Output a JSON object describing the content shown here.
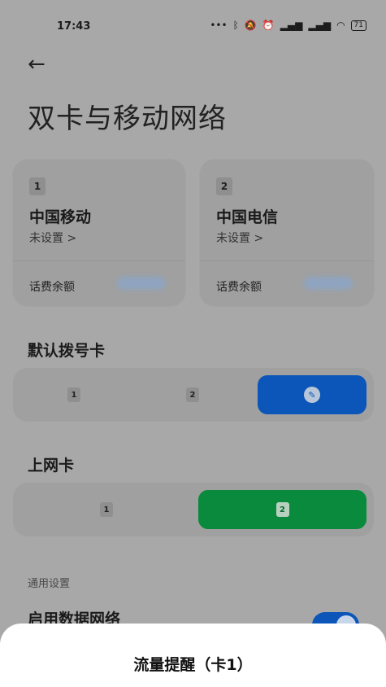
{
  "status_bar": {
    "time": "17:43",
    "battery": "71"
  },
  "header": {
    "title": "双卡与移动网络"
  },
  "sim_cards": [
    {
      "slot": "1",
      "carrier": "中国移动",
      "status": "未设置 >",
      "balance_label": "话费余额"
    },
    {
      "slot": "2",
      "carrier": "中国电信",
      "status": "未设置 >",
      "balance_label": "话费余额"
    }
  ],
  "default_call": {
    "title": "默认拨号卡",
    "options": [
      "1",
      "2"
    ]
  },
  "data_sim": {
    "title": "上网卡",
    "options": [
      "1",
      "2"
    ]
  },
  "general": {
    "label": "通用设置",
    "enable_data_label": "启用数据网络"
  },
  "sheet": {
    "title": "流量提醒（卡1）"
  },
  "colors": {
    "blue_accent": "#0b56b8",
    "green_accent": "#0a8a3c"
  }
}
